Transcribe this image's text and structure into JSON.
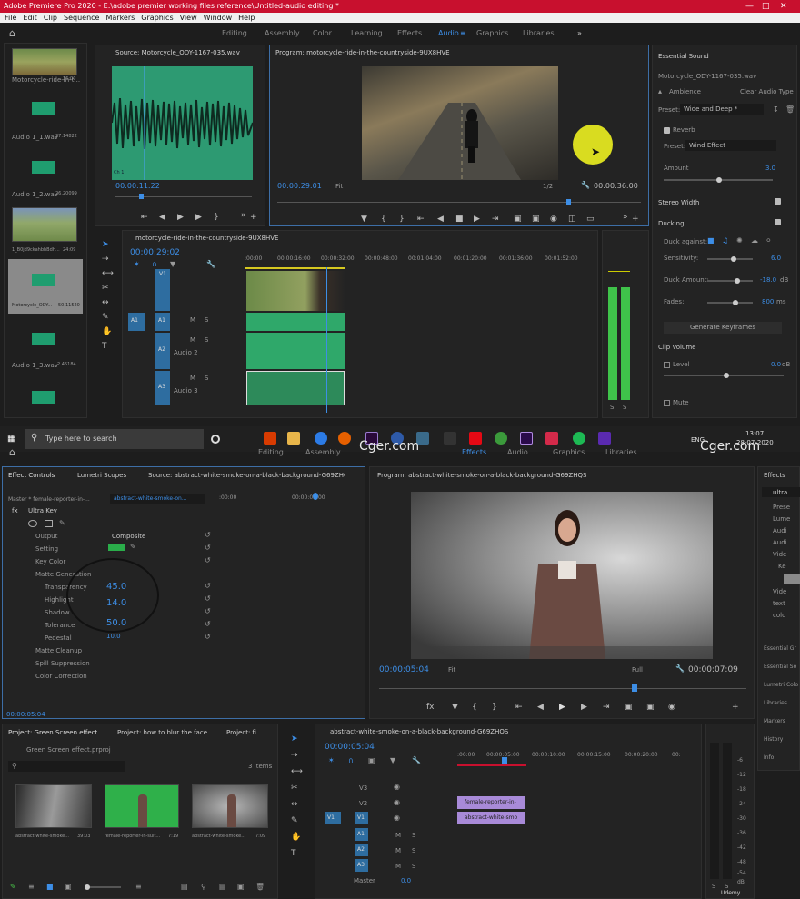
{
  "title_bar": {
    "text": "Adobe Premiere Pro 2020 - E:\\adobe premier working files reference\\Untitled-audio editing *"
  },
  "menu": [
    "File",
    "Edit",
    "Clip",
    "Sequence",
    "Markers",
    "Graphics",
    "View",
    "Window",
    "Help"
  ],
  "workspace_top": {
    "tabs": [
      "Editing",
      "Assembly",
      "Color",
      "Learning",
      "Effects",
      "Audio",
      "Graphics",
      "Libraries"
    ],
    "active": "Audio"
  },
  "project_top": {
    "items": [
      {
        "name": "Motorcycle-ride-in-t...",
        "dur": "36:00"
      },
      {
        "name": "Audio 1_1.wav",
        "dur": "27.14822"
      },
      {
        "name": "Audio 1_2.wav",
        "dur": "26.20099"
      },
      {
        "name": "1_B0jd9ckahbhBdh...",
        "dur": "24:09"
      },
      {
        "name": "Motorcycle_ODY...",
        "dur": "50.11520"
      },
      {
        "name": "Audio 1_3.wav",
        "dur": "2.45184"
      }
    ]
  },
  "source_monitor": {
    "title": "Source: Motorcycle_ODY-1167-035.wav",
    "timecode": "00:00:11:22",
    "label": "Ch 1"
  },
  "program_top": {
    "title": "Program: motorcycle-ride-in-the-countryside-9UX8HVE",
    "timecode": "00:00:29:01",
    "fit": "Fit",
    "res": "1/2",
    "duration": "00:00:36:00"
  },
  "timeline_top": {
    "title": "motorcycle-ride-in-the-countryside-9UX8HVE",
    "timecode": "00:00:29:02",
    "ticks": [
      ":00:00",
      "00:00:16:00",
      "00:00:32:00",
      "00:00:48:00",
      "00:01:04:00",
      "00:01:20:00",
      "00:01:36:00",
      "00:01:52:00"
    ],
    "tracks": [
      {
        "name": "V1"
      },
      {
        "name": "A1"
      },
      {
        "name": "A2",
        "label": "Audio 2"
      },
      {
        "name": "A3",
        "label": "Audio 3"
      }
    ],
    "track_btns": [
      "M",
      "S"
    ]
  },
  "essential_sound": {
    "title": "Essential Sound",
    "clip": "Motorcycle_ODY-1167-035.wav",
    "type": "Ambience",
    "clear": "Clear Audio Type",
    "preset_label": "Preset:",
    "preset": "Wide and Deep *",
    "reverb": "Reverb",
    "reverb_preset": "Wind Effect",
    "amount_label": "Amount",
    "amount": "3.0",
    "stereo": "Stereo Width",
    "ducking": "Ducking",
    "duck_against": "Duck against:",
    "sensitivity_label": "Sensitivity:",
    "sensitivity": "6.0",
    "duck_amount_label": "Duck Amount:",
    "duck_amount": "-18.0",
    "duck_unit": "dB",
    "fades_label": "Fades:",
    "fades": "800",
    "fades_unit": "ms",
    "generate": "Generate Keyframes",
    "clip_volume": "Clip Volume",
    "level_label": "Level",
    "level": "0.0",
    "level_unit": "dB",
    "mute": "Mute"
  },
  "meter_top": {
    "labels": [
      "S",
      "S"
    ]
  },
  "taskbar": {
    "search": "Type here to search",
    "time": "13:07",
    "date": "28-07-2020",
    "lang": "ENG",
    "watermark": "Cger.com"
  },
  "workspace_bottom": {
    "tabs": [
      "Editing",
      "Assembly",
      "Effects",
      "Audio",
      "Graphics",
      "Libraries"
    ],
    "active": "Effects"
  },
  "effect_controls": {
    "tabs": [
      "Effect Controls",
      "Lumetri Scopes",
      "Source: abstract-white-smoke-on-a-black-background-G69ZHQS.i"
    ],
    "master": "Master * female-reporter-in-...",
    "clip": "abstract-white-smoke-on...",
    "time0": ":00:00",
    "time1": "00:00:05:00",
    "effect": "Ultra Key",
    "output_label": "Output",
    "output": "Composite",
    "setting_label": "Setting",
    "key_color": "Key Color",
    "matte_gen": "Matte Generation",
    "transparency": "Transparency",
    "transparency_val": "45.0",
    "highlight": "Highlight",
    "highlight_val": "14.0",
    "shadow": "Shadow",
    "tolerance": "Tolerance",
    "tolerance_val": "50.0",
    "pedestal": "Pedestal",
    "pedestal_val": "10.0",
    "matte_cleanup": "Matte Cleanup",
    "spill": "Spill Suppression",
    "color_correction": "Color Correction",
    "timecode": "00:00:05:04"
  },
  "program_bottom": {
    "title": "Program: abstract-white-smoke-on-a-black-background-G69ZHQS",
    "timecode": "00:00:05:04",
    "fit": "Fit",
    "res": "Full",
    "duration": "00:00:07:09"
  },
  "effects_panel": {
    "title": "Effects",
    "search": "ultra",
    "folders": [
      "Prese",
      "Lume",
      "Audi",
      "Audi",
      "Vide",
      "Ke",
      "",
      "Vide",
      "text",
      "colo"
    ],
    "sections": [
      "Essential Gr",
      "Essential So",
      "Lumetri Colo",
      "Libraries",
      "Markers",
      "History",
      "Info"
    ]
  },
  "project_bottom": {
    "tabs": [
      "Project: Green Screen effect",
      "Project: how to blur the face",
      "Project: fi"
    ],
    "file": "Green Screen effect.prproj",
    "items_count": "3 Items",
    "items": [
      {
        "name": "abstract-white-smoke...",
        "dur": "39:03"
      },
      {
        "name": "female-reporter-in-suit...",
        "dur": "7:19"
      },
      {
        "name": "abstract-white-smoke...",
        "dur": "7:09"
      }
    ]
  },
  "timeline_bottom": {
    "title": "abstract-white-smoke-on-a-black-background-G69ZHQS",
    "timecode": "00:00:05:04",
    "ticks": [
      ":00:00",
      "00:00:05:00",
      "00:00:10:00",
      "00:00:15:00",
      "00:00:20:00",
      "00:"
    ],
    "tracks": [
      "V3",
      "V2",
      "V1",
      "A1",
      "A2",
      "A3"
    ],
    "master": "Master",
    "master_val": "0.0",
    "clip1": "female-reporter-in-",
    "clip2": "abstract-white-smo",
    "v1tag": "V1",
    "track_btns": [
      "M",
      "S"
    ]
  },
  "meter_bottom": {
    "ticks": [
      "-6",
      "-12",
      "-18",
      "-24",
      "-30",
      "-36",
      "-42",
      "-48",
      "-54",
      "dB"
    ],
    "labels": [
      "S",
      "S"
    ]
  },
  "udemy": "Udemy"
}
